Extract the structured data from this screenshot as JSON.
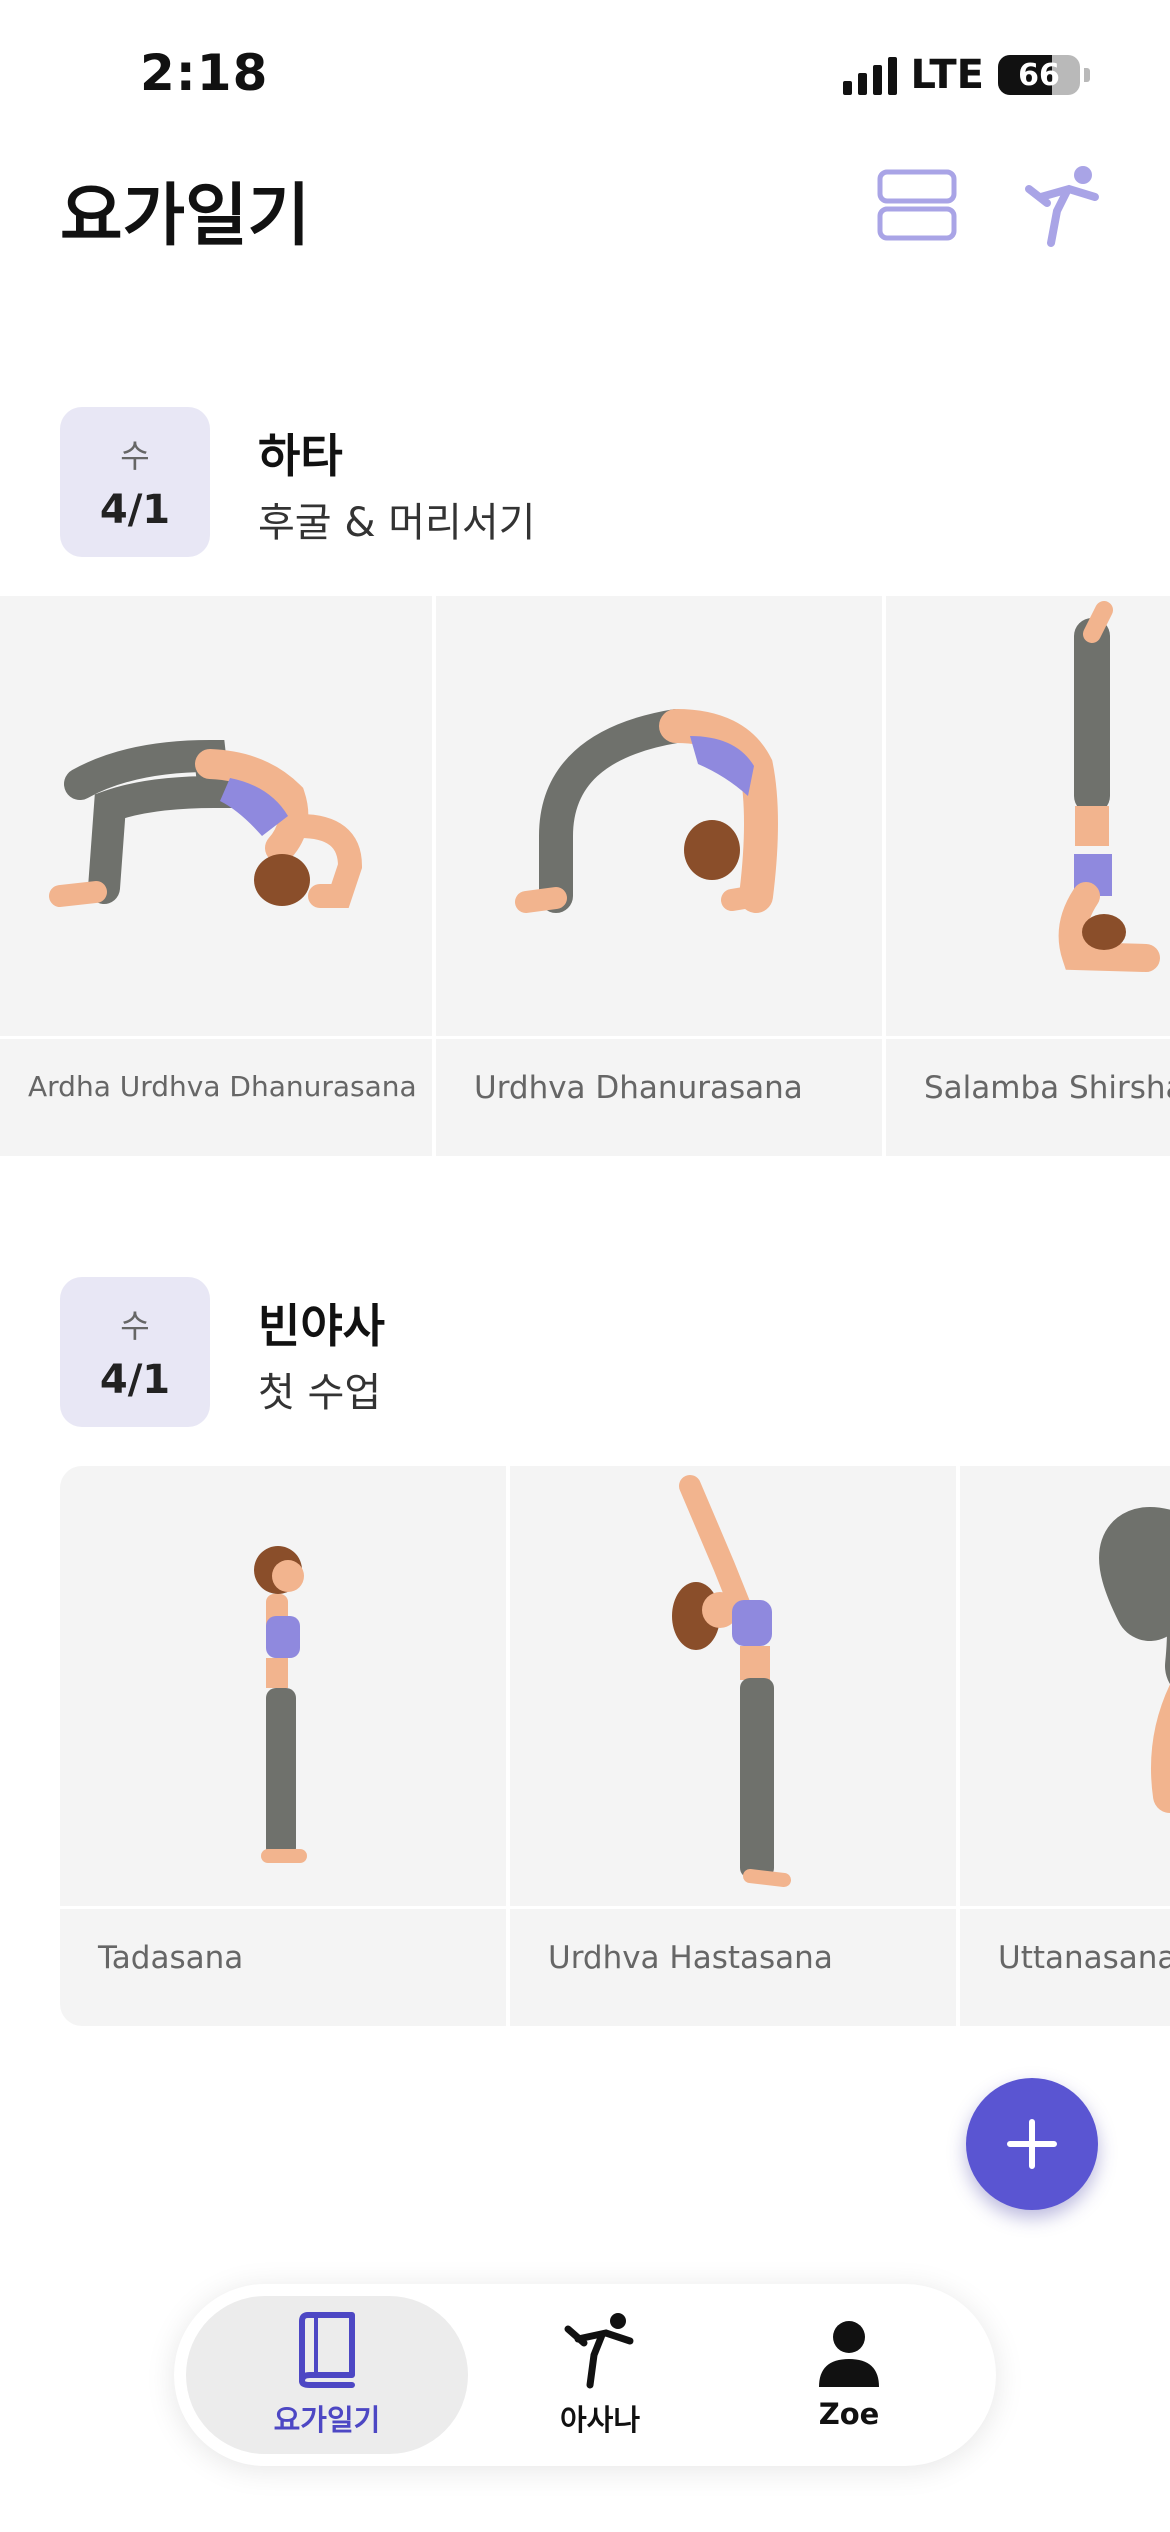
{
  "status_bar": {
    "time": "2:18",
    "network": "LTE",
    "battery": "66",
    "battery_level": 0.66
  },
  "header": {
    "title": "요가일기",
    "layout_icon": "layout-rows-icon",
    "profile_icon": "yoga-pose-icon"
  },
  "sections": [
    {
      "weekday": "수",
      "date": "4/1",
      "title": "하타",
      "subtitle": "후굴 & 머리서기",
      "poses": [
        "Ardha Urdhva Dhanurasana",
        "Urdhva Dhanurasana",
        "Salamba Shirshasana"
      ]
    },
    {
      "weekday": "수",
      "date": "4/1",
      "title": "빈야사",
      "subtitle": "첫 수업",
      "poses": [
        "Tadasana",
        "Urdhva Hastasana",
        "Uttanasana"
      ]
    }
  ],
  "fab": {
    "icon": "plus-icon"
  },
  "tabbar": {
    "tabs": [
      {
        "label": "요가일기",
        "icon": "book-icon",
        "active": true
      },
      {
        "label": "아사나",
        "icon": "yoga-pose-icon",
        "active": false
      },
      {
        "label": "Zoe",
        "icon": "person-icon",
        "active": false
      }
    ]
  },
  "colors": {
    "accent": "#5a55d2",
    "badge_bg": "#e8e7f5",
    "card_bg": "#f4f4f4",
    "icon_lavender": "#a9a4e6"
  }
}
